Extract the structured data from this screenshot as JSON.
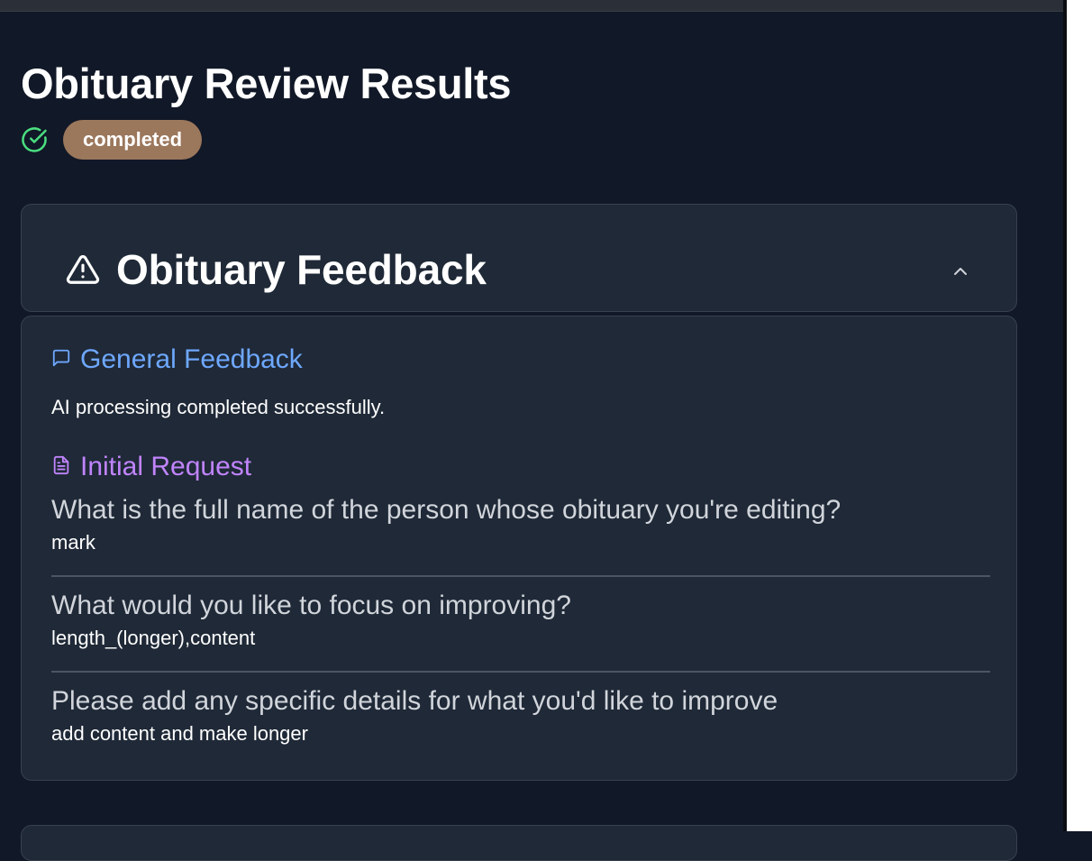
{
  "page": {
    "title": "Obituary Review Results",
    "status": "completed",
    "status_icon": "check-circle-icon"
  },
  "colors": {
    "background": "#111827",
    "card": "#1f2937",
    "status_badge": "#9b775c",
    "status_icon": "#4ade80",
    "general_heading": "#6ea8fe",
    "initial_heading": "#c084fc"
  },
  "feedback_card": {
    "title": "Obituary Feedback",
    "title_icon": "warning-triangle-icon",
    "toggle_icon": "chevron-up-icon",
    "expanded": true
  },
  "general_feedback": {
    "heading": "General Feedback",
    "icon": "message-square-icon",
    "text": "AI processing completed successfully."
  },
  "initial_request": {
    "heading": "Initial Request",
    "icon": "document-icon",
    "items": [
      {
        "question": "What is the full name of the person whose obituary you're editing?",
        "answer": "mark"
      },
      {
        "question": "What would you like to focus on improving?",
        "answer": "length_(longer),content"
      },
      {
        "question": "Please add any specific details for what you'd like to improve",
        "answer": "add content and make longer"
      }
    ]
  }
}
